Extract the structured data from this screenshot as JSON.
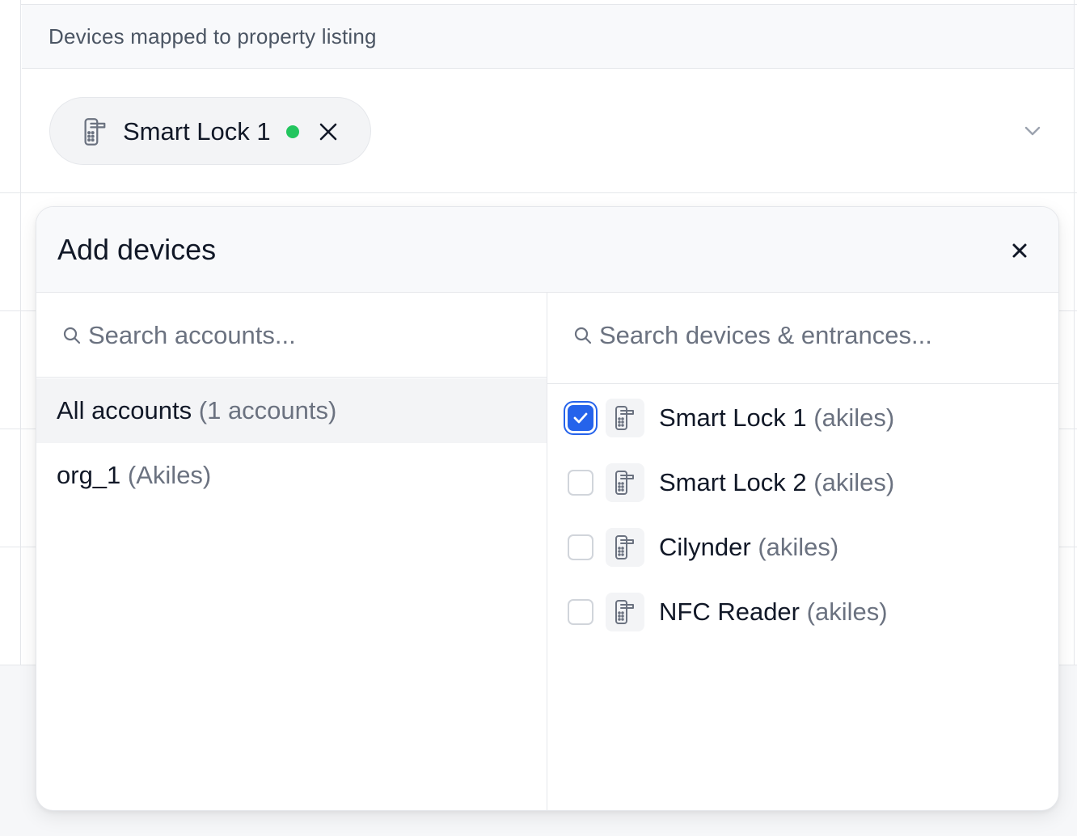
{
  "table": {
    "column_header": "Devices mapped to property listing"
  },
  "selected_chip": {
    "label": "Smart Lock 1",
    "status_color": "#22c55e",
    "icon": "smart-lock-icon"
  },
  "popover": {
    "title": "Add devices",
    "accounts": {
      "search_placeholder": "Search accounts...",
      "items": [
        {
          "name": "All accounts",
          "meta": "(1 accounts)",
          "active": true
        },
        {
          "name": "org_1",
          "meta": "(Akiles)",
          "active": false
        }
      ]
    },
    "devices": {
      "search_placeholder": "Search devices & entrances...",
      "items": [
        {
          "name": "Smart Lock 1",
          "meta": "(akiles)",
          "checked": true,
          "icon": "smart-lock-icon"
        },
        {
          "name": "Smart Lock 2",
          "meta": "(akiles)",
          "checked": false,
          "icon": "smart-lock-icon"
        },
        {
          "name": "Cilynder",
          "meta": "(akiles)",
          "checked": false,
          "icon": "smart-lock-icon"
        },
        {
          "name": "NFC Reader",
          "meta": "(akiles)",
          "checked": false,
          "icon": "smart-lock-icon"
        }
      ]
    }
  },
  "colors": {
    "accent": "#2563eb",
    "online": "#22c55e",
    "muted_text": "#6b7280"
  }
}
